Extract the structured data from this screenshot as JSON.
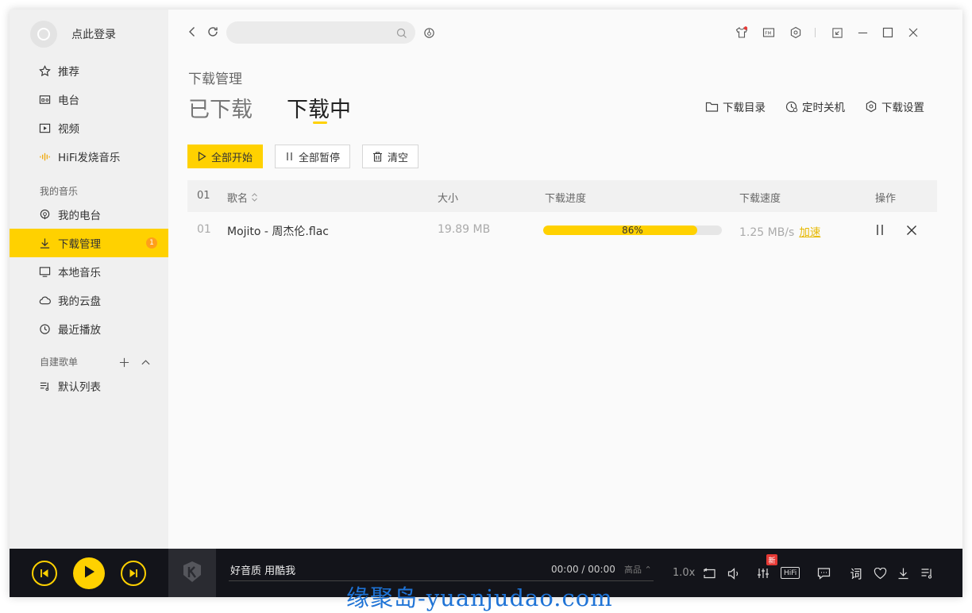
{
  "user": {
    "login_label": "点此登录"
  },
  "sidebar": {
    "items": [
      {
        "label": "推荐",
        "icon": "star-icon"
      },
      {
        "label": "电台",
        "icon": "radio-icon"
      },
      {
        "label": "视频",
        "icon": "video-icon"
      },
      {
        "label": "HiFi发烧音乐",
        "icon": "soundwave-icon"
      }
    ],
    "my_music_label": "我的音乐",
    "my_music_items": [
      {
        "label": "我的电台",
        "icon": "podcast-icon"
      },
      {
        "label": "下载管理",
        "icon": "download-icon",
        "badge": "1",
        "active": true
      },
      {
        "label": "本地音乐",
        "icon": "monitor-icon"
      },
      {
        "label": "我的云盘",
        "icon": "cloud-icon"
      },
      {
        "label": "最近播放",
        "icon": "clock-icon"
      }
    ],
    "playlists_label": "自建歌单",
    "playlists": [
      {
        "label": "默认列表",
        "icon": "playlist-icon"
      }
    ]
  },
  "page": {
    "caption": "下载管理",
    "tabs": [
      {
        "label": "已下载"
      },
      {
        "label": "下载中",
        "active": true
      }
    ],
    "actions": [
      {
        "label": "下载目录",
        "icon": "folder-icon"
      },
      {
        "label": "定时关机",
        "icon": "timer-icon"
      },
      {
        "label": "下载设置",
        "icon": "settings-hex-icon"
      }
    ],
    "buttons": {
      "start_all": "全部开始",
      "pause_all": "全部暂停",
      "clear": "清空"
    }
  },
  "table": {
    "columns": {
      "index": "01",
      "name": "歌名",
      "size": "大小",
      "progress": "下载进度",
      "speed": "下载速度",
      "ops": "操作"
    },
    "rows": [
      {
        "index": "01",
        "name": "Mojito - 周杰伦.flac",
        "size": "19.89 MB",
        "progress": 86,
        "progress_label": "86%",
        "speed": "1.25 MB/s",
        "accelerate": "加速"
      }
    ]
  },
  "player": {
    "song": "好音质 用酷我",
    "time": "00:00 / 00:00",
    "quality": "高品 ⌃",
    "speed": "1.0x",
    "new_badge": "新",
    "hifi_label": "HiFi",
    "lyric_label": "词"
  },
  "watermark": "缘聚岛-yuanjudao.com",
  "colors": {
    "accent": "#ffd100",
    "player_bg": "#13141a",
    "badge": "#ff9f1a"
  }
}
